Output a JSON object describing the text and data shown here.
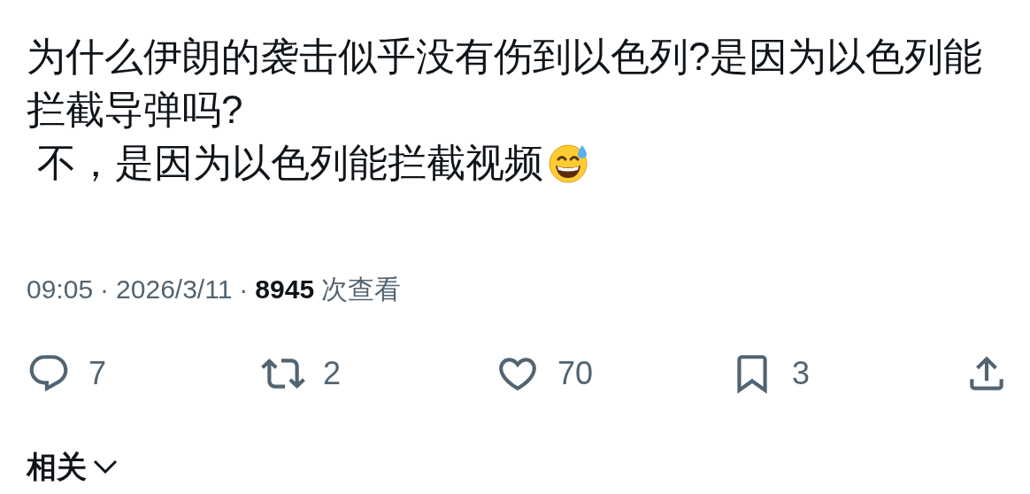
{
  "post": {
    "lines": [
      {
        "kind": "plain",
        "text": "为什么伊朗的袭击似乎没有伤到以色列?是因为以色列能"
      },
      {
        "kind": "plain",
        "text": "拦截导弹吗?"
      },
      {
        "kind": "with_emoji",
        "text": " 不，是因为以色列能拦截视频"
      }
    ]
  },
  "meta": {
    "time": "09:05",
    "separator": "·",
    "date": "2026/3/11",
    "views": "8945",
    "views_label": "次查看"
  },
  "actions": [
    {
      "kind": "reply",
      "count": "7"
    },
    {
      "kind": "repost",
      "count": "2"
    },
    {
      "kind": "like",
      "count": "70"
    },
    {
      "kind": "bookmark",
      "count": "3"
    },
    {
      "kind": "share"
    }
  ],
  "related": {
    "label": "相关"
  }
}
